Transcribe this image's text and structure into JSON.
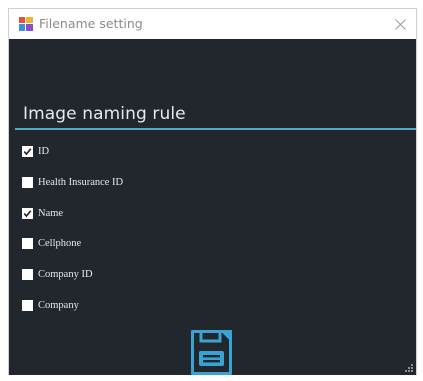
{
  "window": {
    "title": "Filename setting",
    "icon": "app-window-icon",
    "close_icon": "close-icon"
  },
  "section": {
    "heading": "Image naming rule",
    "accent_color": "#55a7c6",
    "background_color": "#22272e"
  },
  "options": [
    {
      "label": "ID",
      "checked": true
    },
    {
      "label": "Health Insurance ID",
      "checked": false
    },
    {
      "label": "Name",
      "checked": true
    },
    {
      "label": "Cellphone",
      "checked": false
    },
    {
      "label": "Company ID",
      "checked": false
    },
    {
      "label": "Company",
      "checked": false
    }
  ],
  "save_button": {
    "icon": "save-icon",
    "color": "#3aa3d6"
  }
}
